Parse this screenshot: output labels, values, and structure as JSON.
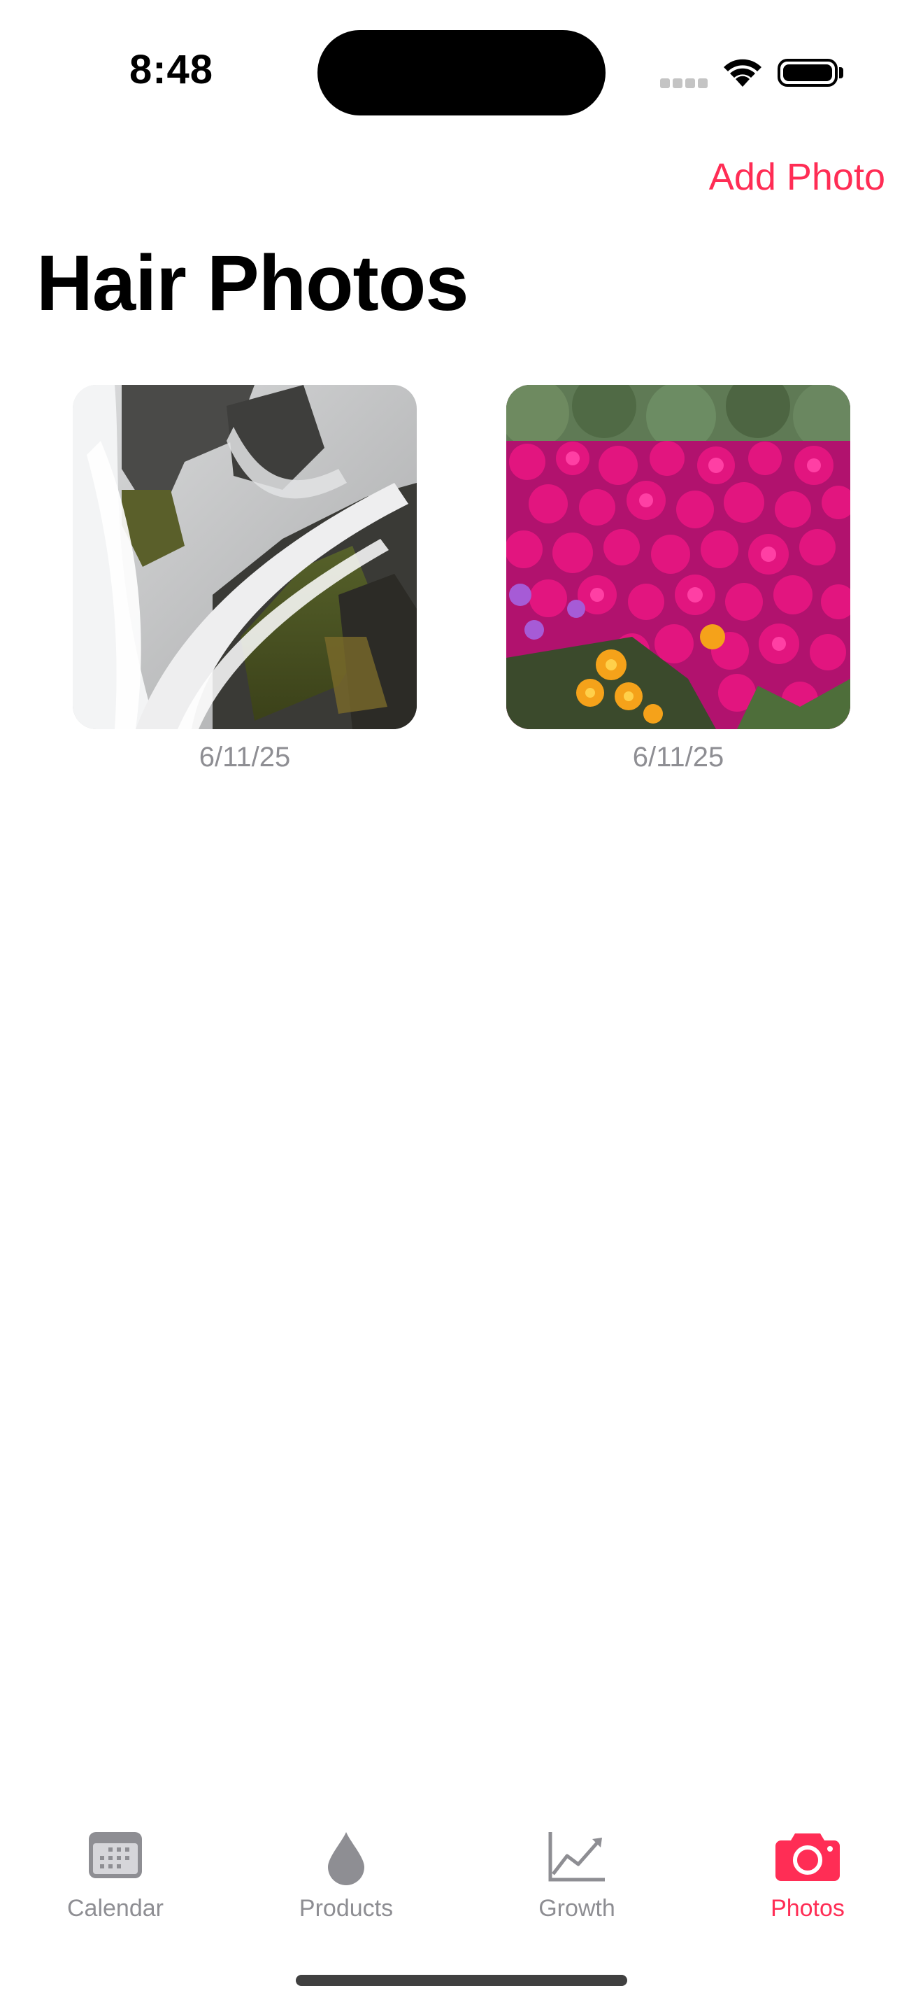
{
  "status_bar": {
    "time": "8:48"
  },
  "nav": {
    "add_photo_label": "Add Photo",
    "title": "Hair Photos"
  },
  "photos": [
    {
      "date": "6/11/25",
      "image": "waterfall-photo"
    },
    {
      "date": "6/11/25",
      "image": "flowers-photo"
    }
  ],
  "tabs": [
    {
      "label": "Calendar",
      "icon": "calendar-icon",
      "active": false
    },
    {
      "label": "Products",
      "icon": "drop-icon",
      "active": false
    },
    {
      "label": "Growth",
      "icon": "chart-line-icon",
      "active": false
    },
    {
      "label": "Photos",
      "icon": "camera-icon",
      "active": true
    }
  ],
  "colors": {
    "accent": "#ff2d55",
    "inactive_tab": "#8e8e93",
    "date_text": "#8e8e93"
  }
}
